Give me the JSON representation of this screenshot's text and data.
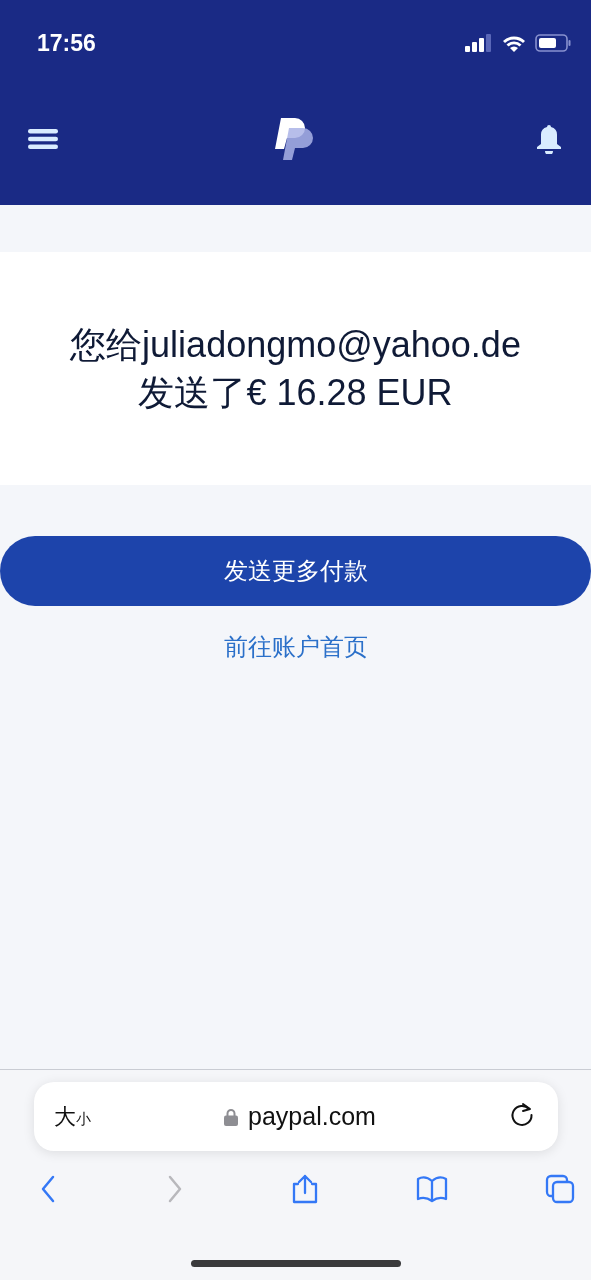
{
  "status_bar": {
    "time": "17:56"
  },
  "confirmation": {
    "message": "您给juliadongmo@yahoo.de 发送了€ 16.28 EUR"
  },
  "actions": [
    {
      "kind": "primary",
      "label": "发送更多付款"
    },
    {
      "kind": "link",
      "label": "前往账户首页"
    }
  ],
  "browser": {
    "text_size": "大$_{小}$",
    "url": "paypal.com",
    "toolbar": [
      {
        "kind": "back",
        "disabled": false
      },
      {
        "kind": "forward",
        "disabled": true
      },
      {
        "kind": "share",
        "disabled": false
      },
      {
        "kind": "bookmarks",
        "disabled": false
      },
      {
        "kind": "tabs",
        "disabled": false
      }
    ]
  }
}
